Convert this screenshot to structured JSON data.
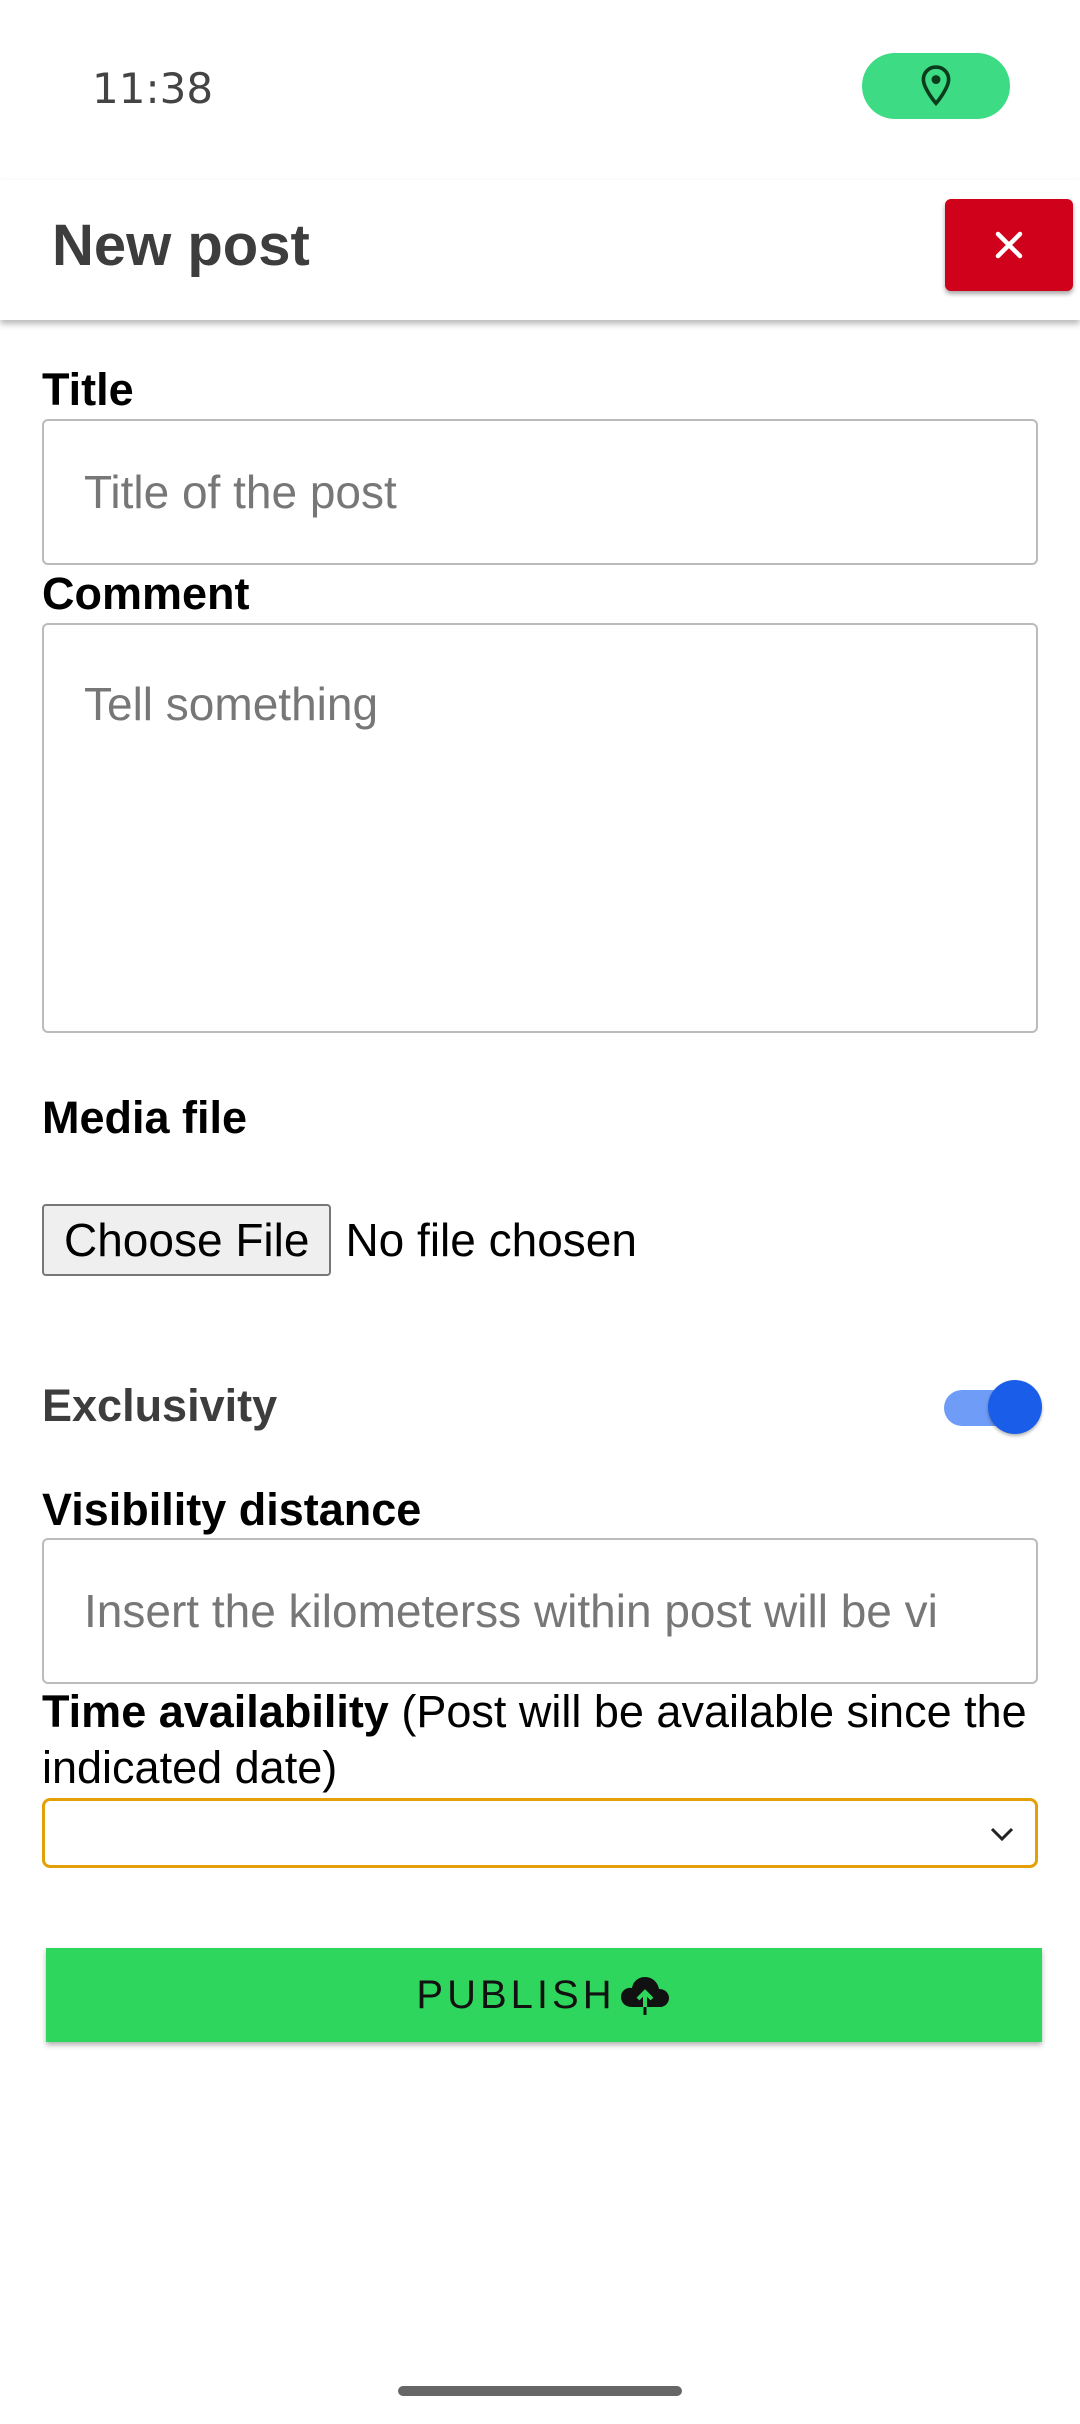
{
  "status_bar": {
    "time": "11:38",
    "location_icon": "location-pin-icon",
    "pill_color": "#3ddc84"
  },
  "header": {
    "title": "New post",
    "close_icon": "close-icon",
    "close_color": "#d0021b"
  },
  "form": {
    "title": {
      "label": "Title",
      "placeholder": "Title of the post",
      "value": ""
    },
    "comment": {
      "label": "Comment",
      "placeholder": "Tell something",
      "value": ""
    },
    "media": {
      "label": "Media file",
      "button_label": "Choose File",
      "status": "No file chosen"
    },
    "exclusivity": {
      "label": "Exclusivity",
      "enabled": true
    },
    "visibility_distance": {
      "label": "Visibility distance",
      "placeholder": "Insert the kilometerss within post will be vi",
      "value": ""
    },
    "time_availability": {
      "label_bold": "Time availability",
      "label_note": " (Post will be available since the indicated date)",
      "selected": ""
    }
  },
  "publish": {
    "label": "PUBLISH",
    "icon": "cloud-upload-icon",
    "color": "#2fd65d"
  }
}
